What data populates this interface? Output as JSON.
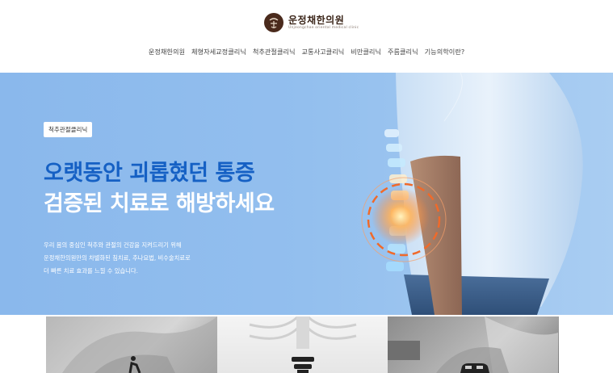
{
  "brand": {
    "name": "운정채한의원",
    "subtitle": "Unjeongchae oriental medical clinic"
  },
  "nav": {
    "items": [
      "운정채한의원",
      "체형자세교정클리닉",
      "척추관절클리닉",
      "교통사고클리닉",
      "비만클리닉",
      "주름클리닉",
      "기능의학이란?"
    ]
  },
  "hero": {
    "badge": "척추관절클리닉",
    "title_line1": "오랫동안 괴롭혔던 통증",
    "title_line2": "검증된 치료로 해방하세요",
    "desc_lines": [
      "우리 몸의 중심인 척추와 관절의 건강을 지켜드리기 위해",
      "운정채한의원만의 차별화된 침치료, 추나요법, 비수술치료로",
      "더 빠른 치료 효과를 느낄 수 있습니다."
    ]
  },
  "colors": {
    "hero_bg": "#93bfee",
    "title_blue": "#1560c4",
    "pain_orange": "#f06a2a"
  },
  "cards": {
    "icons": [
      "person-pain-icon",
      "spine-icon",
      "car-icon"
    ]
  }
}
